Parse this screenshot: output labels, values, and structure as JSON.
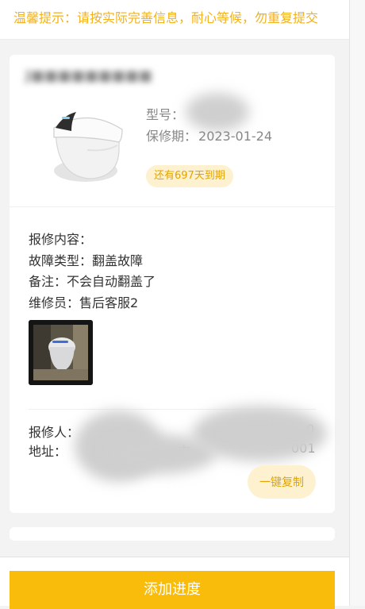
{
  "notice": {
    "text": "温馨提示：请按实际完善信息，耐心等候，勿重复提交"
  },
  "product": {
    "shop_name": "J■■■■■■■■■",
    "model_label": "型号：",
    "model_value": "",
    "warranty_label": "保修期：",
    "warranty_value": "2023-01-24",
    "expire_badge": "还有697天到期",
    "image_icon": "smart-toilet-icon"
  },
  "repair": {
    "content_label": "报修内容：",
    "fault_label": "故障类型：",
    "fault_value": "翻盖故障",
    "remark_label": "备注：",
    "remark_value": "不会自动翻盖了",
    "technician_label": "维修员：",
    "technician_value": "售后客服2",
    "photo_icon": "repair-photo-thumbnail"
  },
  "contact": {
    "reporter_label": "报修人：",
    "address_label": "地址：",
    "address_fragment": "市",
    "address_tail": "001",
    "phone_fragment": "甲",
    "phone_tail": "0"
  },
  "actions": {
    "copy_label": "一键复制",
    "add_progress_label": "添加进度"
  },
  "colors": {
    "accent": "#f9bc0b",
    "notice_text": "#f1b21d",
    "badge_bg": "#fdf1cf",
    "badge_text": "#e3a400"
  }
}
